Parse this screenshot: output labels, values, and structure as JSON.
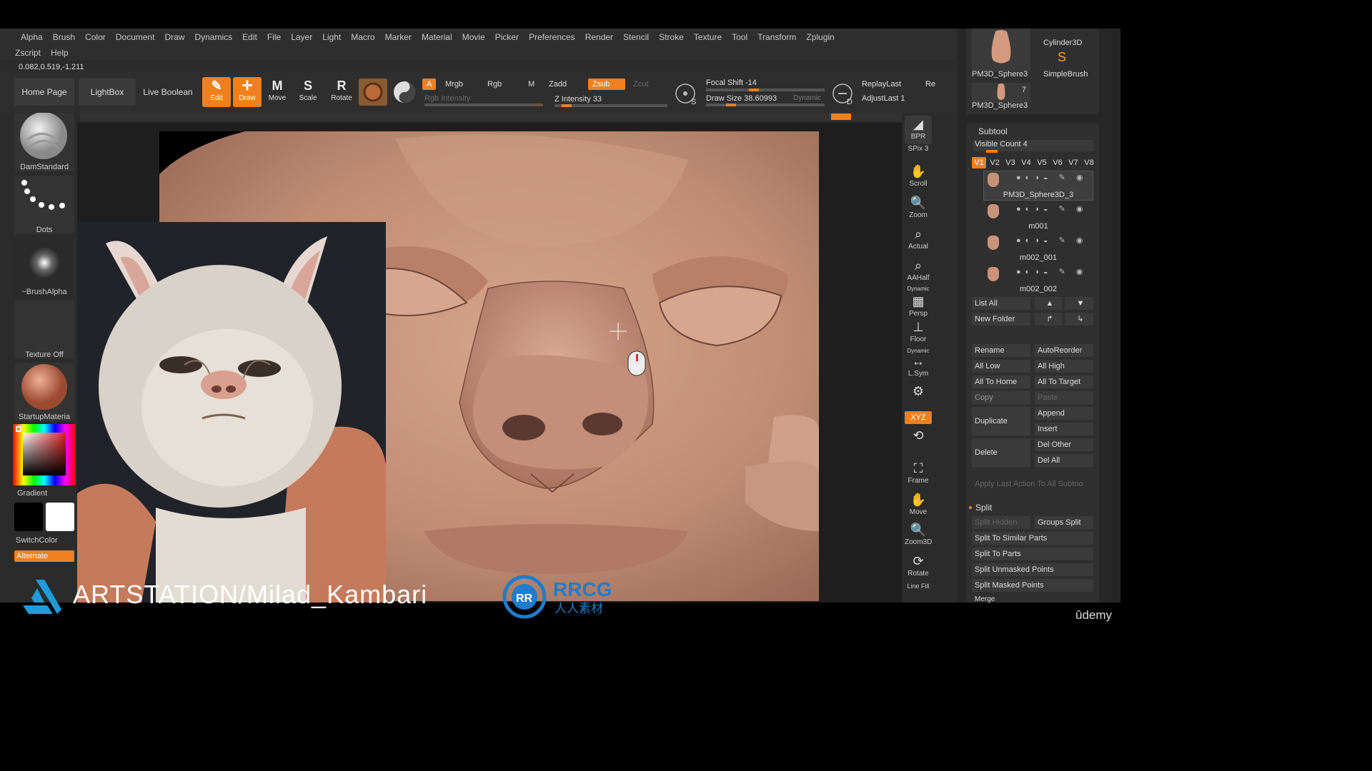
{
  "menu": {
    "row1": [
      "Alpha",
      "Brush",
      "Color",
      "Document",
      "Draw",
      "Dynamics",
      "Edit",
      "File",
      "Layer",
      "Light",
      "Macro",
      "Marker",
      "Material",
      "Movie",
      "Picker",
      "Preferences",
      "Render",
      "Stencil",
      "Stroke",
      "Texture",
      "Tool",
      "Transform",
      "Zplugin"
    ],
    "row2": [
      "Zscript",
      "Help"
    ]
  },
  "coords": "0.082,0.519,-1.211",
  "toolbar": {
    "home": "Home Page",
    "lightbox": "LightBox",
    "live_boolean": "Live Boolean",
    "edit": "Edit",
    "draw": "Draw",
    "move": "Move",
    "scale": "Scale",
    "rotate": "Rotate",
    "a": "A",
    "mrgb": "Mrgb",
    "rgb": "Rgb",
    "m": "M",
    "rgb_intensity": "Rgb Intensity",
    "zadd": "Zadd",
    "zsub": "Zsub",
    "zcut": "Zcut",
    "z_intensity": "Z Intensity 33",
    "z_intensity_value": 0.33,
    "focal_shift": "Focal Shift -14",
    "draw_size": "Draw Size 38.60993",
    "dynamic": "Dynamic",
    "replay_last": "ReplayLast",
    "re": "Re",
    "adjust_last": "AdjustLast 1"
  },
  "left_shelf": {
    "brush": "DamStandard",
    "stroke": "Dots",
    "alpha": "~BrushAlpha",
    "texture": "Texture Off",
    "material": "StartupMateria",
    "gradient": "Gradient",
    "switch_color": "SwitchColor",
    "alternate": "Alternate"
  },
  "right_shelf": {
    "bpr": "BPR",
    "spix": "SPix 3",
    "scroll": "Scroll",
    "zoom": "Zoom",
    "actual": "Actual",
    "aahalf": "AAHalf",
    "dynamic": "Dynamic",
    "persp": "Persp",
    "floor": "Floor",
    "dynamic2": "Dynamic",
    "lsym": "L.Sym",
    "xyz": "XYZ",
    "frame": "Frame",
    "move": "Move",
    "zoom3d": "Zoom3D",
    "rotate": "Rotate",
    "line_fill": "Line Fill"
  },
  "tool_panel": {
    "thumbs": [
      "PM3D_Sphere3",
      "SimpleBrush",
      "PM3D_Sphere3"
    ],
    "cylinder": "Cylinder3D",
    "count": "7"
  },
  "subtool": {
    "title": "Subtool",
    "visible_count": "Visible Count 4",
    "versions": [
      "V1",
      "V2",
      "V3",
      "V4",
      "V5",
      "V6",
      "V7",
      "V8"
    ],
    "items": [
      "PM3D_Sphere3D_3",
      "m001",
      "m002_001",
      "m002_002"
    ],
    "list_all": "List All",
    "new_folder": "New Folder",
    "rename": "Rename",
    "auto_reorder": "AutoReorder",
    "all_low": "All Low",
    "all_high": "All High",
    "all_to_home": "All To Home",
    "all_to_target": "All To Target",
    "copy": "Copy",
    "paste": "Paste",
    "duplicate": "Duplicate",
    "append": "Append",
    "insert": "Insert",
    "delete": "Delete",
    "del_other": "Del Other",
    "del_all": "Del All",
    "apply_last": "Apply Last Action To All Subtoo",
    "split": "Split",
    "split_hidden": "Split Hidden",
    "groups_split": "Groups Split",
    "split_similar": "Split To Similar Parts",
    "split_parts": "Split To Parts",
    "split_unmasked": "Split Unmasked Points",
    "split_masked": "Split Masked Points",
    "merge": "Merge"
  },
  "watermark": {
    "artstation": "ARTSTATION/Milad_Kambari",
    "rrcg": "RRCG",
    "rrcg_sub": "人人素材",
    "udemy": "ûdemy"
  },
  "colors": {
    "accent": "#f0801e",
    "skin": "#c2907a"
  }
}
